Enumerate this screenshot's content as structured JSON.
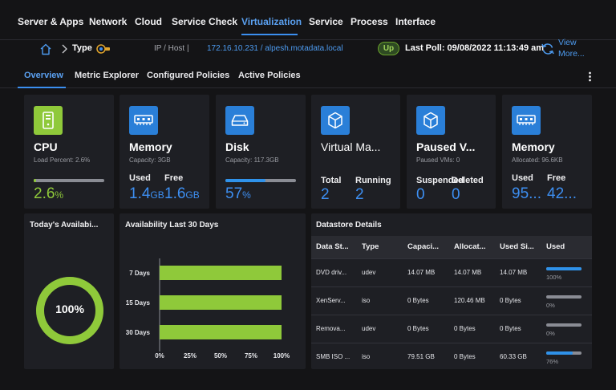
{
  "topnav": {
    "items": [
      "Server & Apps",
      "Network",
      "Cloud",
      "Service Check",
      "Virtualization",
      "Service",
      "Process",
      "Interface"
    ],
    "active": "Virtualization"
  },
  "breadcrumb": {
    "type_label": "Type",
    "ip_host_label": "IP / Host |",
    "ip_host_value": "172.16.10.231 / alpesh.motadata.local",
    "status": "Up",
    "last_poll": "Last Poll: 09/08/2022 11:13:49 am",
    "view_more": "View More..."
  },
  "subtabs": {
    "items": [
      "Overview",
      "Metric Explorer",
      "Configured Policies",
      "Active Policies"
    ],
    "active": "Overview"
  },
  "tiles": {
    "cpu": {
      "title": "CPU",
      "sub": "Load Percent: 2.6%",
      "value": "2.6",
      "unit": "%",
      "bar_fraction": 0.03
    },
    "memory": {
      "title": "Memory",
      "sub": "Capacity: 3GB",
      "used_label": "Used",
      "free_label": "Free",
      "used": "1.4",
      "used_unit": "GB",
      "free": "1.6",
      "free_unit": "GB"
    },
    "disk": {
      "title": "Disk",
      "sub": "Capacity: 117.3GB",
      "value": "57",
      "unit": "%",
      "bar_fraction": 0.57
    },
    "vm": {
      "title": "Virtual Ma...",
      "total_label": "Total",
      "running_label": "Running",
      "total": "2",
      "running": "2"
    },
    "paused": {
      "title": "Paused V...",
      "sub": "Paused VMs: 0",
      "suspended_label": "Suspended",
      "deleted_label": "Deleted",
      "suspended": "0",
      "deleted": "0"
    },
    "memory2": {
      "title": "Memory",
      "sub": "Allocated: 96.6KB",
      "used_label": "Used",
      "free_label": "Free",
      "used": "95...",
      "free": "42..."
    }
  },
  "availability_today": {
    "title": "Today's Availabi...",
    "value": "100%",
    "fraction": 1.0
  },
  "chart_data": {
    "type": "bar",
    "orientation": "horizontal",
    "title": "Availability Last 30 Days",
    "categories": [
      "7 Days",
      "15 Days",
      "30 Days"
    ],
    "values": [
      100,
      100,
      100
    ],
    "xticks": [
      "0%",
      "25%",
      "50%",
      "75%",
      "100%"
    ],
    "xlim": [
      0,
      100
    ],
    "color": "#8fc93a"
  },
  "datastore": {
    "title": "Datastore Details",
    "columns": [
      "Data St...",
      "Type",
      "Capaci...",
      "Allocat...",
      "Used Si...",
      "Used"
    ],
    "rows": [
      {
        "name": "DVD driv...",
        "type": "udev",
        "capacity": "14.07 MB",
        "allocated": "14.07 MB",
        "used_size": "14.07 MB",
        "used_pct": "100%",
        "fraction": 1.0
      },
      {
        "name": "XenServ...",
        "type": "iso",
        "capacity": "0 Bytes",
        "allocated": "120.46 MB",
        "used_size": "0 Bytes",
        "used_pct": "0%",
        "fraction": 0
      },
      {
        "name": "Remova...",
        "type": "udev",
        "capacity": "0 Bytes",
        "allocated": "0 Bytes",
        "used_size": "0 Bytes",
        "used_pct": "0%",
        "fraction": 0
      },
      {
        "name": "SMB ISO ...",
        "type": "iso",
        "capacity": "79.51 GB",
        "allocated": "0 Bytes",
        "used_size": "60.33 GB",
        "used_pct": "76%",
        "fraction": 0.76
      }
    ]
  },
  "colors": {
    "accent": "#3d8ff2",
    "green": "#8fc93a",
    "icon_blue": "#2a7fd8",
    "panel": "#1e1f24"
  }
}
